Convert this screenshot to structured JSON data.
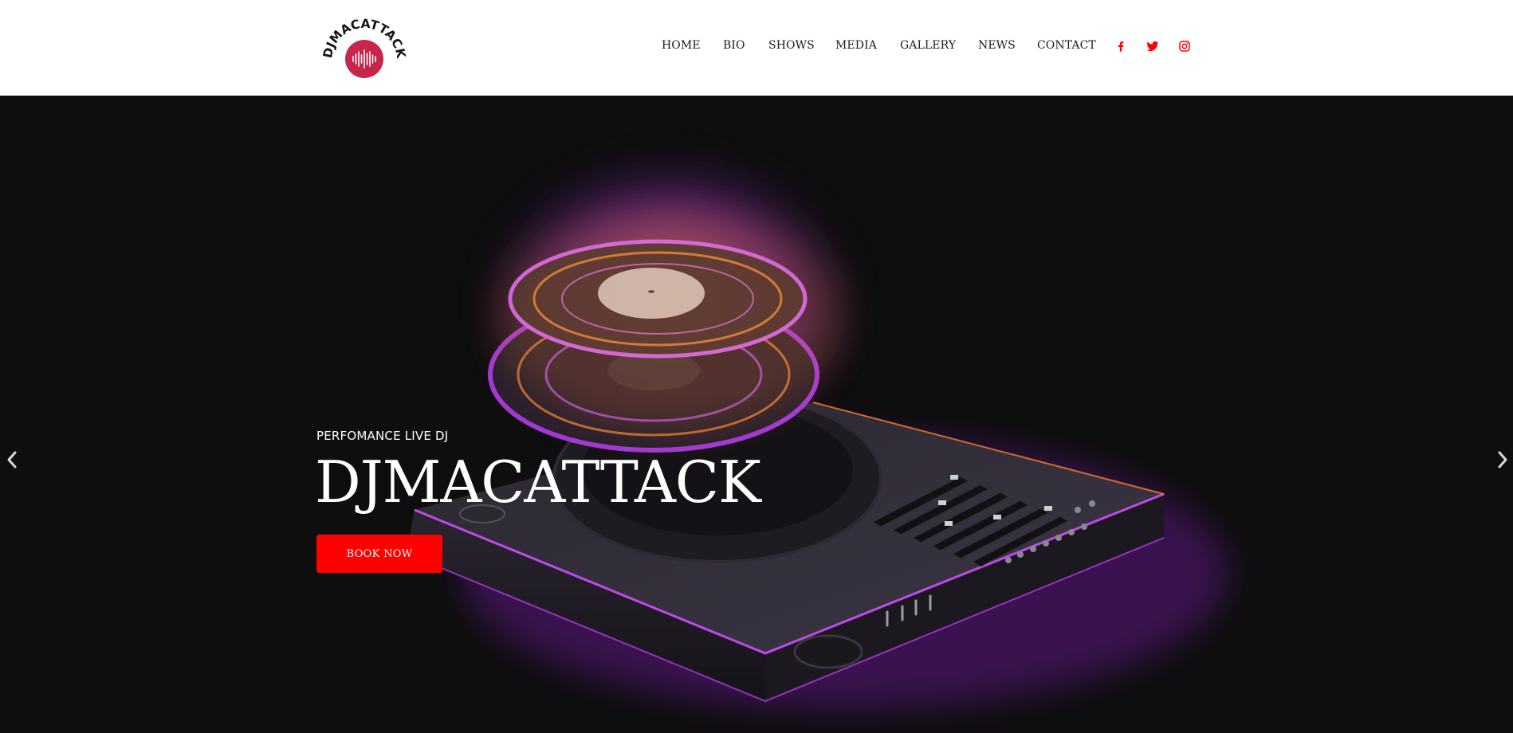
{
  "brand": {
    "logo_text": "DJMACATTACK",
    "logo_color": "#c8254b"
  },
  "nav": {
    "items": [
      {
        "label": "HOME"
      },
      {
        "label": "BIO"
      },
      {
        "label": "SHOWS"
      },
      {
        "label": "MEDIA"
      },
      {
        "label": "GALLERY"
      },
      {
        "label": "NEWS"
      },
      {
        "label": "CONTACT"
      }
    ],
    "social": [
      {
        "icon": "facebook-icon"
      },
      {
        "icon": "twitter-icon"
      },
      {
        "icon": "instagram-icon"
      }
    ],
    "social_color": "#ff0000"
  },
  "hero": {
    "subtitle": "PERFOMANCE LIVE DJ",
    "title": "DJMACATTACK",
    "cta_label": "BOOK NOW",
    "cta_color": "#ff0000",
    "prev_icon": "chevron-left-icon",
    "next_icon": "chevron-right-icon"
  }
}
